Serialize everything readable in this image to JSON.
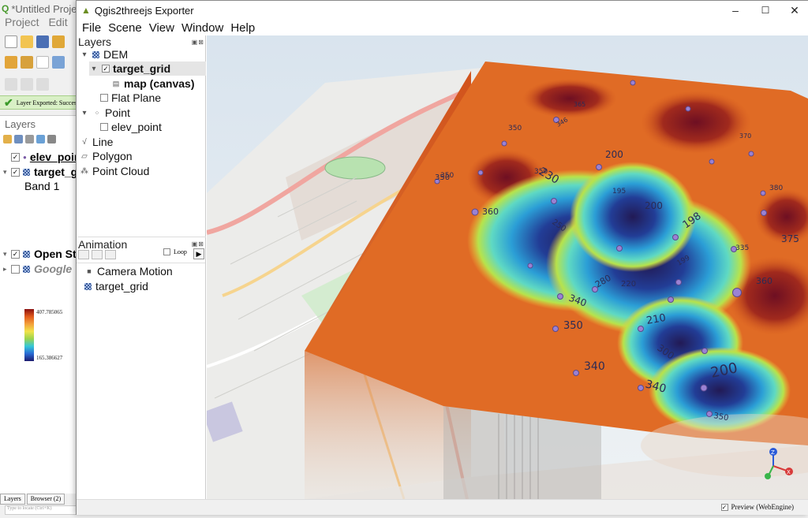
{
  "qgis": {
    "title": "*Untitled Project",
    "menu": [
      "Project",
      "Edit"
    ],
    "message": "Layer Exported: Successfully",
    "layers_title": "Layers",
    "layers": [
      {
        "label": "elev_point",
        "checked": true
      },
      {
        "label": "target_grid",
        "checked": true
      },
      {
        "label": "Open Street Map",
        "checked": true
      },
      {
        "label": "Google",
        "checked": false
      }
    ],
    "band_label": "Band 1",
    "ramp_max": "407.785065",
    "ramp_min": "165.386627",
    "tabs": [
      "Layers",
      "Browser (2)"
    ],
    "locate_placeholder": "Type to locate (Ctrl+K)"
  },
  "exporter": {
    "title": "Qgis2threejs Exporter",
    "window_buttons": {
      "minimize": "–",
      "maximize": "☐",
      "close": "✕"
    },
    "menu": [
      "File",
      "Scene",
      "View",
      "Window",
      "Help"
    ],
    "layers_dock": {
      "title": "Layers",
      "dem_group": "DEM",
      "dem_layer": "target_grid",
      "dem_material": "map (canvas)",
      "flat_plane": "Flat Plane",
      "point_group": "Point",
      "point_layer": "elev_point",
      "line_group": "Line",
      "polygon_group": "Polygon",
      "pointcloud_group": "Point Cloud"
    },
    "animation_dock": {
      "title": "Animation",
      "loop_label": "Loop",
      "play_icon": "▶",
      "items": [
        "Camera Motion",
        "target_grid"
      ]
    },
    "preview_label": "Preview (WebEngine)",
    "scene": {
      "contour_labels": [
        "350",
        "365",
        "346",
        "350",
        "360",
        "350",
        "230",
        "200",
        "195",
        "200",
        "198",
        "350",
        "250",
        "340",
        "280",
        "220",
        "199",
        "375",
        "335",
        "350",
        "210",
        "340",
        "200",
        "300",
        "340",
        "350",
        "360",
        "380",
        "370"
      ],
      "axes": {
        "x": "X",
        "y": "Y",
        "z": "Z"
      }
    }
  }
}
